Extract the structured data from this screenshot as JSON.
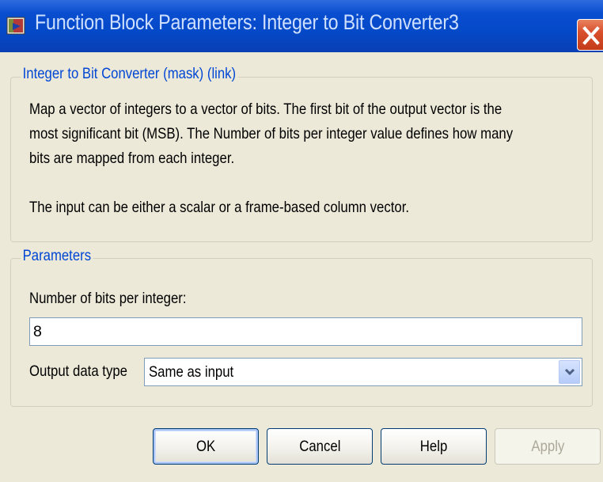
{
  "window": {
    "title": "Function Block Parameters: Integer to Bit Converter3",
    "icon": "simulink-block-icon",
    "close_icon": "close-icon"
  },
  "description_group": {
    "label": "Integer to Bit Converter (mask) (link)",
    "lines": [
      "Map a vector of integers to a vector of bits. The first bit of the output vector is the",
      "most significant bit (MSB). The Number of bits per integer value defines how many",
      "bits are mapped from each integer.",
      "The input can be either a scalar or a frame-based column vector."
    ]
  },
  "parameters_group": {
    "label": "Parameters",
    "bits_label": "Number of bits per integer:",
    "bits_value": "8",
    "output_type_label": "Output data type",
    "output_type_value": "Same as input"
  },
  "buttons": {
    "ok": "OK",
    "cancel": "Cancel",
    "help": "Help",
    "apply": "Apply"
  },
  "colors": {
    "titlebar": "#0449C8",
    "group_label": "#0046D5",
    "dialog_bg": "#ECE9D8",
    "close_button": "#D9502D"
  }
}
